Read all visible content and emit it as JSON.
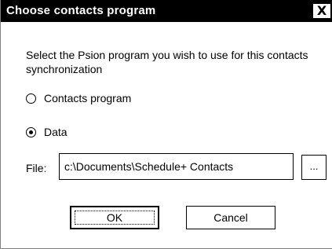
{
  "dialog": {
    "title": "Choose contacts program",
    "close_label": "X",
    "description": "Select the Psion program you wish to use for this contacts synchronization"
  },
  "options": [
    {
      "label": "Contacts program",
      "checked": false
    },
    {
      "label": "Data",
      "checked": true
    }
  ],
  "file": {
    "label": "File:",
    "value": "c:\\Documents\\Schedule+ Contacts",
    "browse_label": "..."
  },
  "buttons": {
    "ok_label": "OK",
    "cancel_label": "Cancel"
  }
}
